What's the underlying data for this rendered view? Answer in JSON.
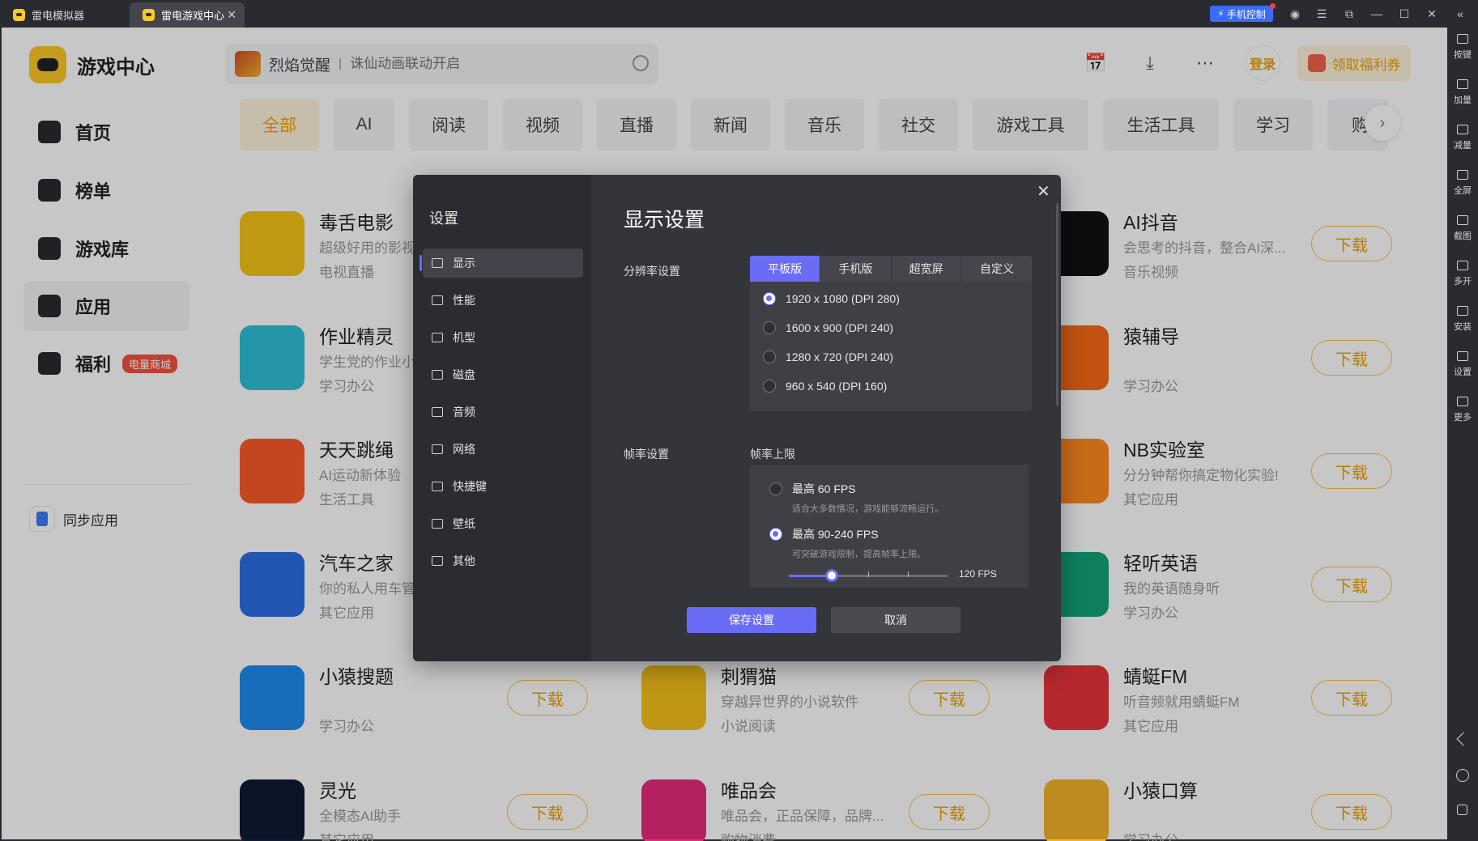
{
  "window": {
    "tabs": [
      {
        "label": "雷电模拟器"
      },
      {
        "label": "雷电游戏中心"
      }
    ],
    "phone_control": "手机控制"
  },
  "right_toolbar": [
    {
      "label": "按键",
      "icon": "keyboard-icon"
    },
    {
      "label": "加量",
      "icon": "volume-up-icon"
    },
    {
      "label": "减量",
      "icon": "volume-down-icon"
    },
    {
      "label": "全屏",
      "icon": "fullscreen-icon"
    },
    {
      "label": "截图",
      "icon": "scissors-icon"
    },
    {
      "label": "多开",
      "icon": "multi-instance-icon"
    },
    {
      "label": "安装",
      "icon": "install-icon"
    },
    {
      "label": "设置",
      "icon": "gear-icon"
    },
    {
      "label": "更多",
      "icon": "more-icon"
    }
  ],
  "sidebar": {
    "title": "游戏中心",
    "items": [
      {
        "label": "首页",
        "icon": "home-icon"
      },
      {
        "label": "榜单",
        "icon": "ranking-icon"
      },
      {
        "label": "游戏库",
        "icon": "gamepad-icon"
      },
      {
        "label": "应用",
        "icon": "apps-icon",
        "active": true
      },
      {
        "label": "福利",
        "icon": "gift-icon",
        "badge": "电量商城"
      }
    ],
    "sync_label": "同步应用"
  },
  "header": {
    "search_hot": "烈焰觉醒",
    "search_placeholder": "诛仙动画联动开启",
    "login_label": "登录",
    "welfare_label": "领取福利券"
  },
  "categories": [
    "全部",
    "AI",
    "阅读",
    "视频",
    "直播",
    "新闻",
    "音乐",
    "社交",
    "游戏工具",
    "生活工具",
    "学习",
    "购"
  ],
  "apps": {
    "download_label": "下载",
    "col1": [
      {
        "name": "毒舌电影",
        "desc": "超级好用的影视",
        "tag": "电视直播",
        "color": "#f5c518"
      },
      {
        "name": "作业精灵",
        "desc": "学生党的作业小",
        "tag": "学习办公",
        "color": "#2ec0d8"
      },
      {
        "name": "天天跳绳",
        "desc": "AI运动新体验",
        "tag": "生活工具",
        "color": "#fb5a2b"
      },
      {
        "name": "汽车之家",
        "desc": "你的私人用车管",
        "tag": "其它应用",
        "color": "#2b6fe8"
      },
      {
        "name": "小猿搜题",
        "desc": "",
        "tag": "学习办公",
        "color": "#1e8cf0"
      },
      {
        "name": "灵光",
        "desc": "全模态AI助手",
        "tag": "其它应用",
        "color": "#101a33"
      }
    ],
    "col2": [
      {
        "name": "刺猬猫",
        "desc": "穿越异世界的小说软件",
        "tag": "小说阅读",
        "color": "#f6c21b"
      },
      {
        "name": "唯品会",
        "desc": "唯品会，正品保障，品牌...",
        "tag": "购物消费",
        "color": "#e62b7a"
      }
    ],
    "col3": [
      {
        "name": "AI抖音",
        "desc": "会思考的抖音，整合AI深...",
        "tag": "音乐视频",
        "color": "#111111"
      },
      {
        "name": "猿辅导",
        "desc": "",
        "tag": "学习办公",
        "color": "#f86a16"
      },
      {
        "name": "NB实验室",
        "desc": "分分钟帮你搞定物化实验!",
        "tag": "其它应用",
        "color": "#ff8a1e"
      },
      {
        "name": "轻听英语",
        "desc": "我的英语随身听",
        "tag": "学习办公",
        "color": "#12a37a"
      },
      {
        "name": "蜻蜓FM",
        "desc": "听音频就用蜻蜓FM",
        "tag": "其它应用",
        "color": "#e8353b"
      },
      {
        "name": "小猿口算",
        "desc": "",
        "tag": "学习办公",
        "color": "#f3b22a"
      }
    ]
  },
  "dialog": {
    "title": "设置",
    "heading": "显示设置",
    "menu": [
      {
        "label": "显示",
        "icon": "monitor-icon"
      },
      {
        "label": "性能",
        "icon": "performance-icon"
      },
      {
        "label": "机型",
        "icon": "device-icon"
      },
      {
        "label": "磁盘",
        "icon": "disk-icon"
      },
      {
        "label": "音频",
        "icon": "audio-icon"
      },
      {
        "label": "网络",
        "icon": "globe-icon"
      },
      {
        "label": "快捷键",
        "icon": "keyboard-icon"
      },
      {
        "label": "壁纸",
        "icon": "palette-icon"
      },
      {
        "label": "其他",
        "icon": "grid-icon"
      }
    ],
    "resolution_label": "分辨率设置",
    "resolution_tabs": [
      "平板版",
      "手机版",
      "超宽屏",
      "自定义"
    ],
    "resolutions": [
      "1920 x 1080  (DPI 280)",
      "1600 x 900  (DPI 240)",
      "1280 x 720  (DPI 240)",
      "960 x 540  (DPI 160)"
    ],
    "selected_resolution": 0,
    "fps_label": "帧率设置",
    "fps_limit_label": "帧率上限",
    "fps_options": [
      {
        "label": "最高 60 FPS",
        "desc": "适合大多数情况，游戏能够流畅运行。"
      },
      {
        "label": "最高 90-240 FPS",
        "desc": "可突破游戏限制，提高帧率上限。"
      }
    ],
    "fps_value": "120 FPS",
    "fps_slider_fraction": 0.27,
    "save_label": "保存设置",
    "cancel_label": "取消"
  }
}
